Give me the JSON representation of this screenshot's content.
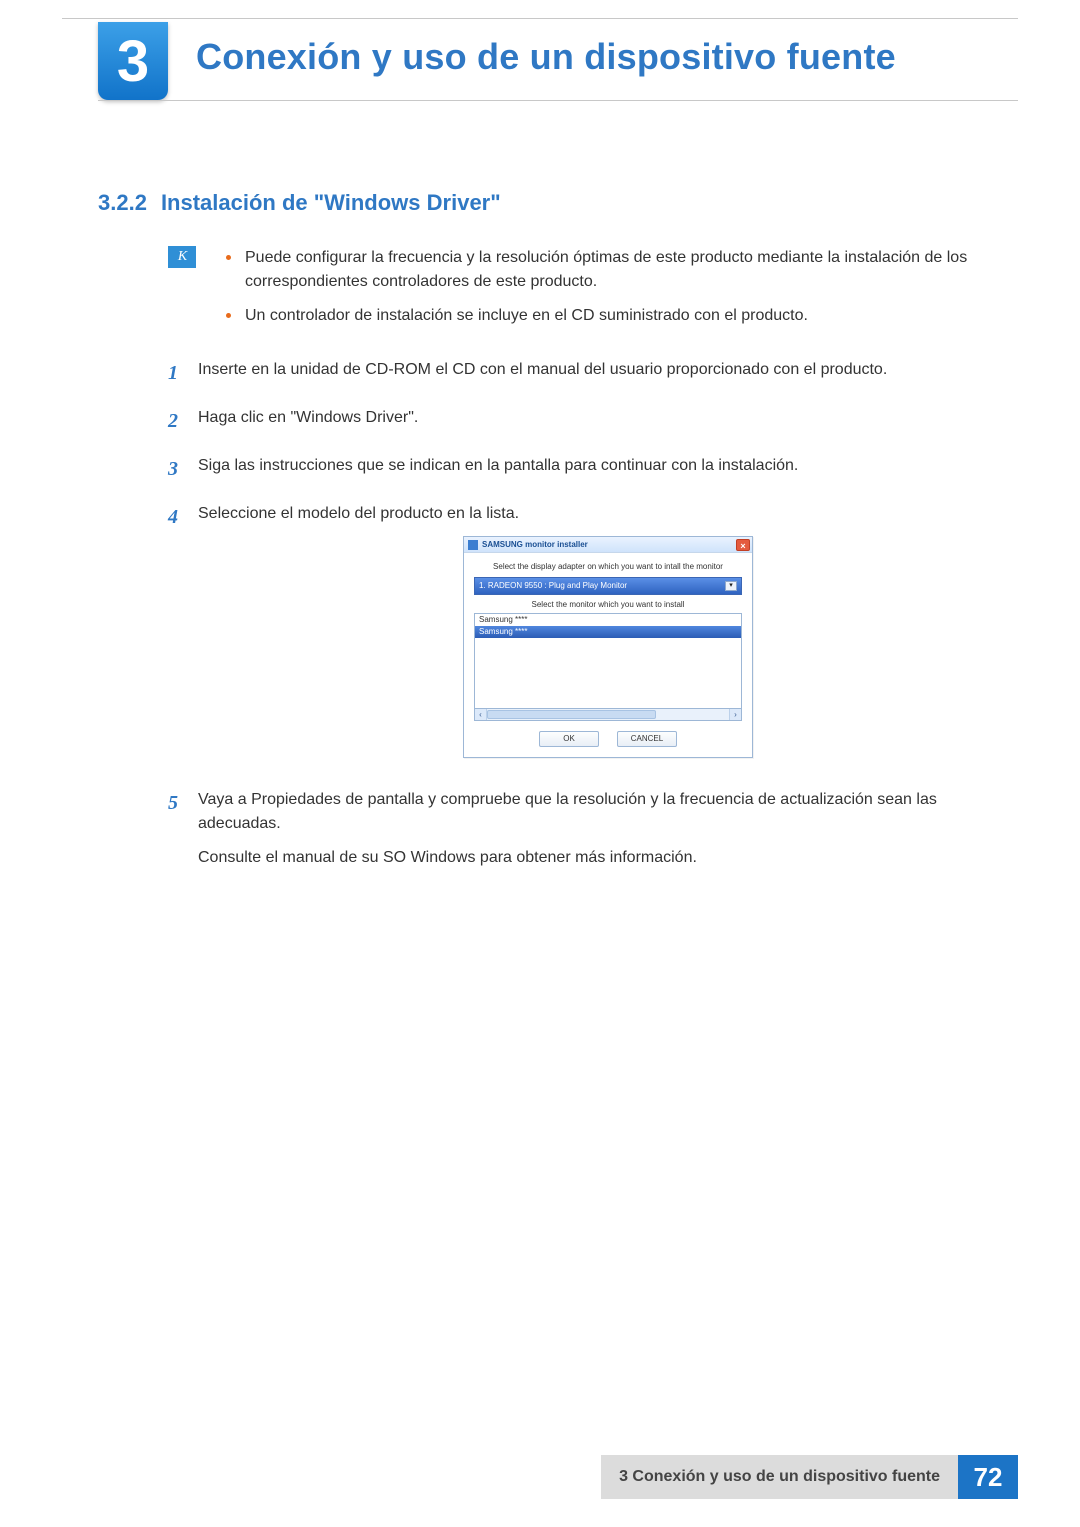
{
  "chapter": {
    "number": "3",
    "title": "Conexión y uso de un dispositivo fuente"
  },
  "section": {
    "number": "3.2.2",
    "title": "Instalación de \"Windows Driver\""
  },
  "note": {
    "bullets": [
      "Puede configurar la frecuencia y la resolución óptimas de este producto mediante la instalación de los correspondientes controladores de este producto.",
      "Un controlador de instalación se incluye en el CD suministrado con el producto."
    ]
  },
  "steps": [
    {
      "n": "1",
      "text": "Inserte en la unidad de CD-ROM el CD con el manual del usuario proporcionado con el producto."
    },
    {
      "n": "2",
      "text": "Haga clic en \"Windows Driver\"."
    },
    {
      "n": "3",
      "text": "Siga las instrucciones que se indican en la pantalla para continuar con la instalación."
    },
    {
      "n": "4",
      "text": "Seleccione el modelo del producto en la lista."
    },
    {
      "n": "5",
      "text": "Vaya a Propiedades de pantalla y compruebe que la resolución y la frecuencia de actualización sean las adecuadas.",
      "after": "Consulte el manual de su SO Windows para obtener más información."
    }
  ],
  "dialog": {
    "title": "SAMSUNG monitor installer",
    "hint_adapter": "Select the display adapter on which you want to intall the monitor",
    "adapter_selected": "1. RADEON 9550 : Plug and Play Monitor",
    "hint_monitor": "Select the monitor which you want to install",
    "monitors": [
      "Samsung ****",
      "Samsung ****"
    ],
    "buttons": {
      "ok": "OK",
      "cancel": "CANCEL"
    }
  },
  "footer": {
    "label": "3 Conexión y uso de un dispositivo fuente",
    "page": "72"
  }
}
